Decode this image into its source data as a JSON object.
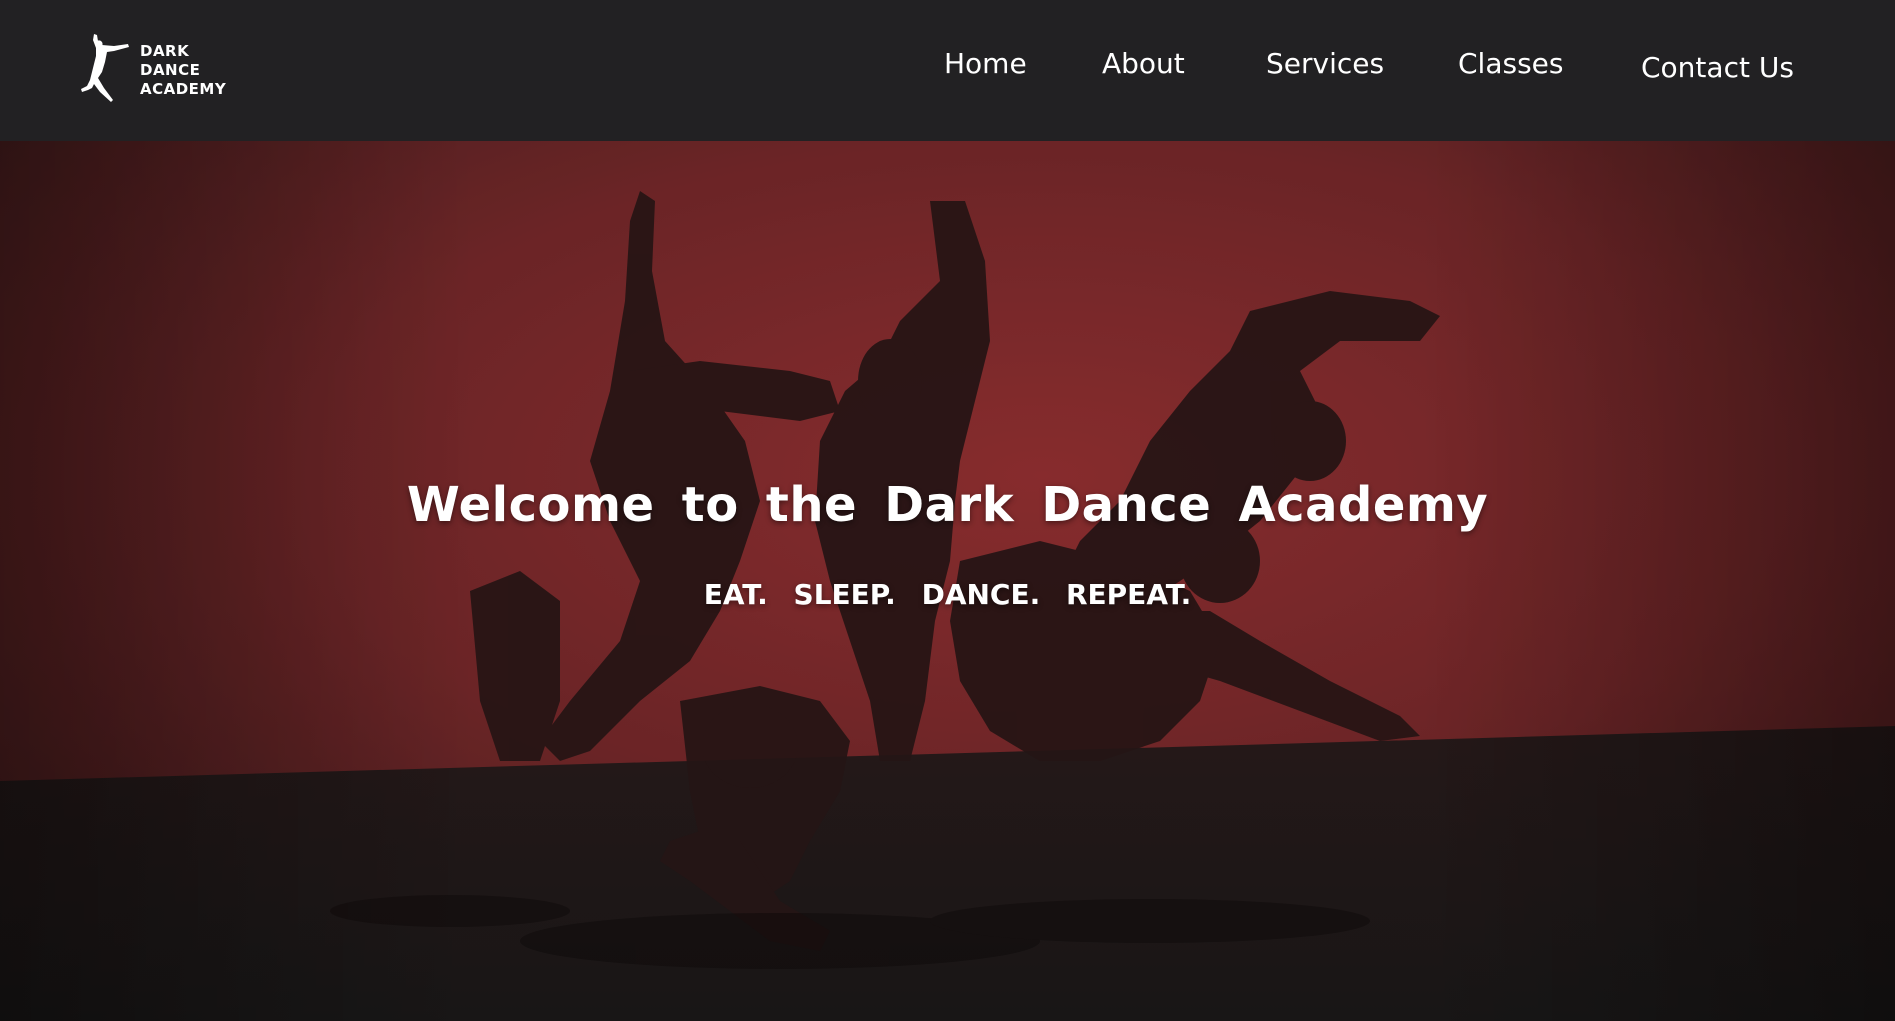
{
  "brand": {
    "logo_icon": "dancer-silhouette-icon",
    "line1": "DARK",
    "line2": "DANCE",
    "line3": "ACADEMY"
  },
  "nav": {
    "home": "Home",
    "about": "About",
    "services": "Services",
    "classes": "Classes",
    "contact": "Contact Us"
  },
  "hero": {
    "title": "Welcome to the Dark Dance Academy",
    "tagline": "EAT. SLEEP. DANCE. REPEAT.",
    "background_image": "dancers-silhouette-red-stage"
  },
  "colors": {
    "header_bg": "#222123",
    "hero_backdrop": "#7a2c2e",
    "text": "#ffffff"
  }
}
